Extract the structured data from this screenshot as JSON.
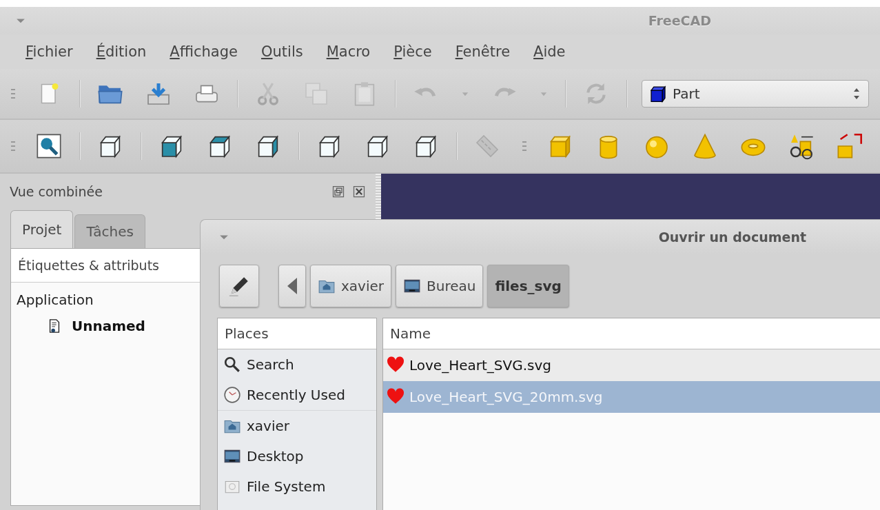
{
  "window": {
    "title": "FreeCAD"
  },
  "menu": [
    "Fichier",
    "Édition",
    "Affichage",
    "Outils",
    "Macro",
    "Pièce",
    "Fenêtre",
    "Aide"
  ],
  "toolbar_rows": [
    {
      "toolbars": [
        {
          "groups": [
            {
              "items": [
                {
                  "kind": "new",
                  "disabled": false
                }
              ]
            },
            {
              "items": [
                {
                  "kind": "open",
                  "disabled": false
                },
                {
                  "kind": "save",
                  "disabled": false
                },
                {
                  "kind": "print",
                  "disabled": false
                }
              ]
            },
            {
              "items": [
                {
                  "kind": "cut",
                  "disabled": true
                },
                {
                  "kind": "copy",
                  "disabled": true
                },
                {
                  "kind": "paste",
                  "disabled": true
                }
              ]
            },
            {
              "items": [
                {
                  "kind": "undo",
                  "disabled": true
                },
                {
                  "kind": "menu-arrow",
                  "disabled": true
                },
                {
                  "kind": "redo",
                  "disabled": true
                },
                {
                  "kind": "menu-arrow",
                  "disabled": true
                }
              ]
            },
            {
              "items": [
                {
                  "kind": "refresh",
                  "disabled": true
                }
              ]
            }
          ]
        }
      ]
    },
    {
      "toolbars": [
        {
          "groups": [
            {
              "items": [
                {
                  "kind": "zoom-fit",
                  "disabled": false
                }
              ]
            },
            {
              "items": [
                {
                  "kind": "cube-iso",
                  "disabled": false
                }
              ]
            },
            {
              "items": [
                {
                  "kind": "cube-front",
                  "disabled": false
                },
                {
                  "kind": "cube-top",
                  "disabled": false
                },
                {
                  "kind": "cube-right",
                  "disabled": false
                }
              ]
            },
            {
              "items": [
                {
                  "kind": "cube-rear",
                  "disabled": false
                },
                {
                  "kind": "cube-bottom",
                  "disabled": false
                },
                {
                  "kind": "cube-left",
                  "disabled": false
                }
              ]
            },
            {
              "items": [
                {
                  "kind": "ruler",
                  "disabled": true
                }
              ]
            }
          ]
        },
        {
          "groups": [
            {
              "items": [
                {
                  "kind": "box",
                  "disabled": false
                },
                {
                  "kind": "cylinder",
                  "disabled": false
                },
                {
                  "kind": "sphere",
                  "disabled": false
                },
                {
                  "kind": "cone",
                  "disabled": false
                },
                {
                  "kind": "torus",
                  "disabled": false
                },
                {
                  "kind": "primitives",
                  "disabled": false
                },
                {
                  "kind": "shape-builder",
                  "disabled": false
                }
              ]
            }
          ]
        }
      ]
    }
  ],
  "workbench": {
    "value": "Part"
  },
  "combo_view": {
    "title": "Vue combinée",
    "tabs": [
      {
        "label": "Projet",
        "selected": true
      },
      {
        "label": "Tâches",
        "selected": false
      }
    ],
    "tree": {
      "column": "Étiquettes & attributs",
      "items": [
        {
          "label": "Application",
          "active": false,
          "children": [
            {
              "label": "Unnamed",
              "active": true
            }
          ]
        }
      ]
    }
  },
  "dialog": {
    "title": "Ouvrir un document",
    "path": [
      {
        "label": "xavier",
        "kind": "home",
        "selected": false
      },
      {
        "label": "Bureau",
        "kind": "desktop",
        "selected": false
      },
      {
        "label": "files_svg",
        "kind": "folder",
        "selected": true
      }
    ],
    "places": {
      "header": "Places",
      "sections": [
        {
          "items": [
            {
              "label": "Search",
              "kind": "search"
            },
            {
              "label": "Recently Used",
              "kind": "recent"
            }
          ]
        },
        {
          "items": [
            {
              "label": "xavier",
              "kind": "home"
            },
            {
              "label": "Desktop",
              "kind": "desktop"
            },
            {
              "label": "File System",
              "kind": "drive"
            }
          ]
        }
      ]
    },
    "files": {
      "column": "Name",
      "rows": [
        {
          "name": "Love_Heart_SVG.svg",
          "selected": false
        },
        {
          "name": "Love_Heart_SVG_20mm.svg",
          "selected": true
        }
      ]
    }
  }
}
